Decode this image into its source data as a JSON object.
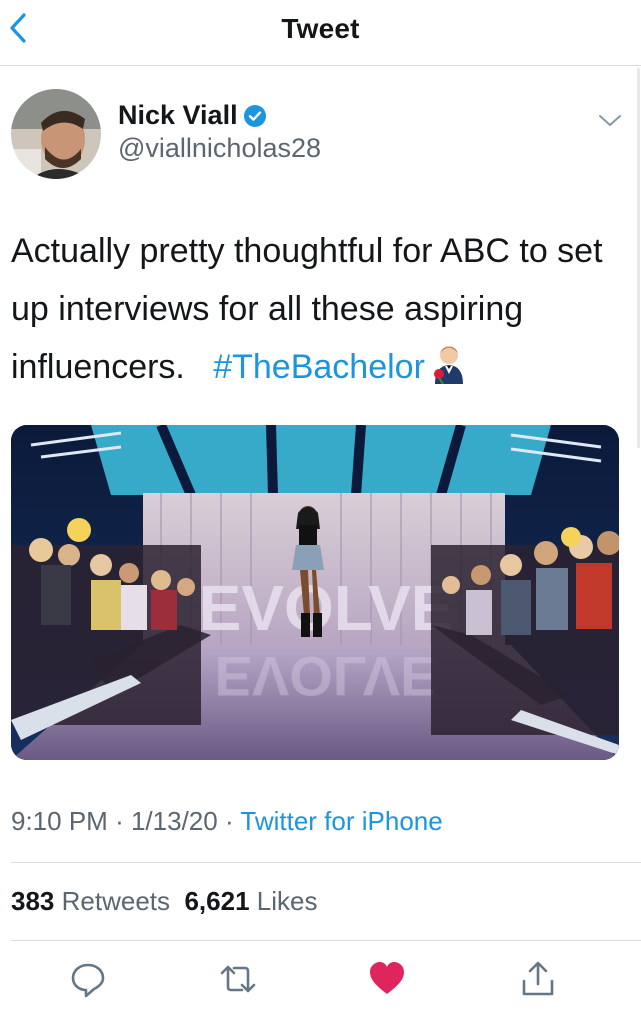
{
  "header": {
    "title": "Tweet",
    "back_icon": "chevron-left-icon",
    "accent_color": "#1b95e0"
  },
  "tweet": {
    "author": {
      "name": "Nick Viall",
      "handle": "@viallnicholas28",
      "verified": true
    },
    "text_main": "Actually pretty thoughtful for ABC to set up interviews for all these aspiring influencers.",
    "hashtag": "#TheBachelor",
    "emoji_icon": "man-in-tuxedo-with-rose-icon",
    "media_text": "EVOLVE",
    "time": "9:10 PM",
    "separator": "·",
    "date": "1/13/20",
    "source": "Twitter for iPhone",
    "retweets_count": "383",
    "retweets_label": "Retweets",
    "likes_count": "6,621",
    "likes_label": "Likes",
    "liked": true,
    "like_color": "#e0245e"
  },
  "actions": [
    "reply-icon",
    "retweet-icon",
    "like-icon",
    "share-icon"
  ]
}
